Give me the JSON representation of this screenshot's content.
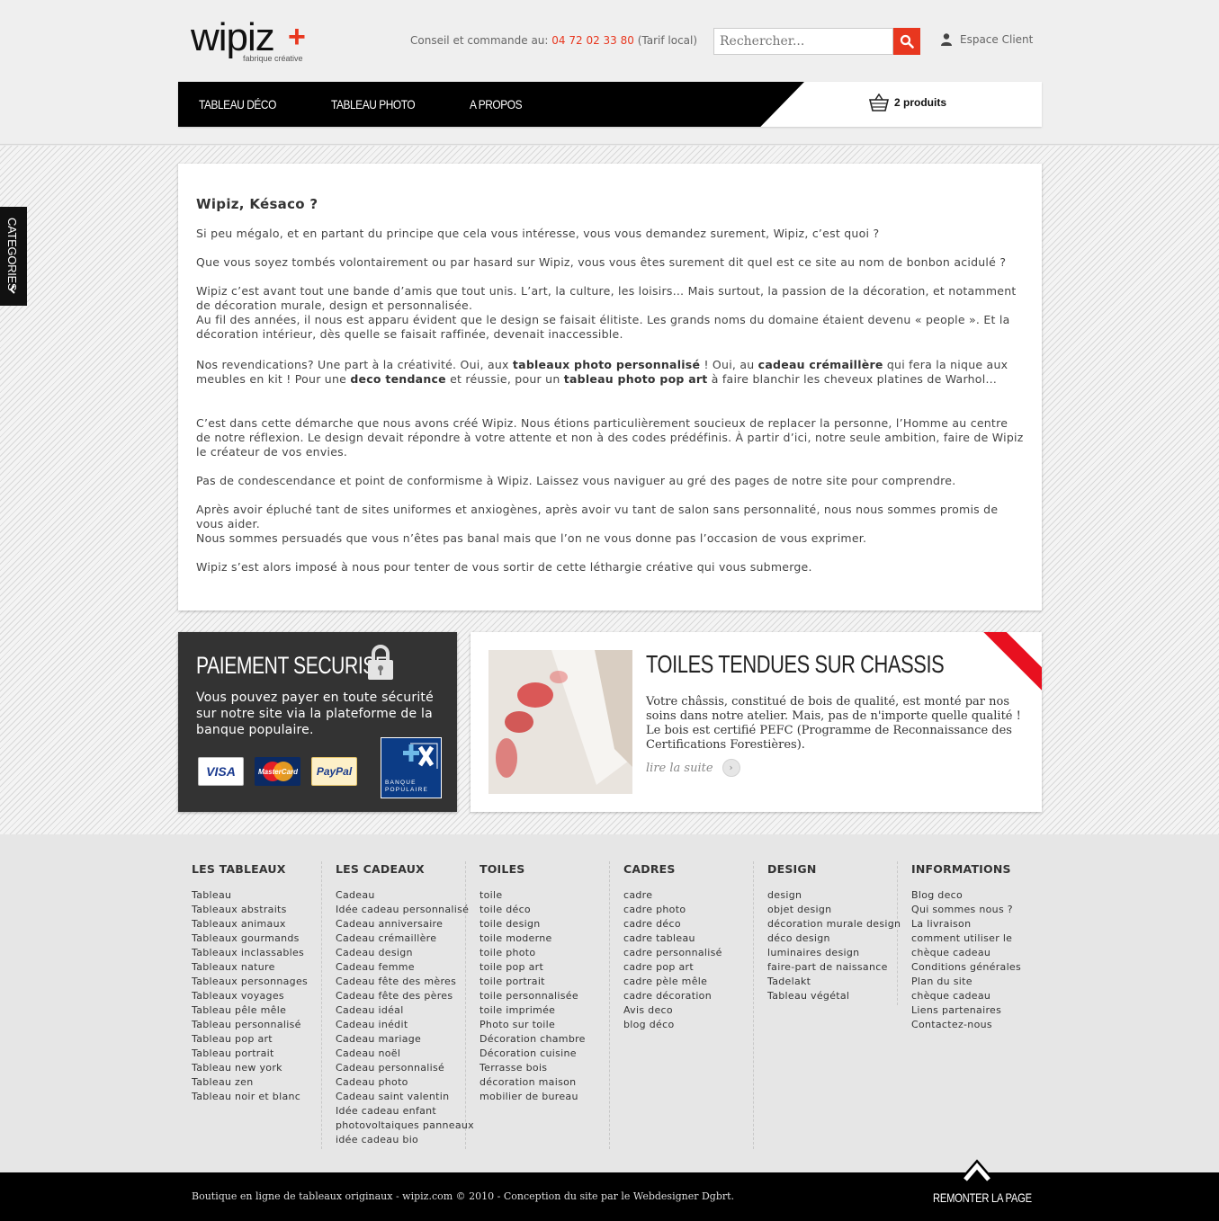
{
  "header": {
    "logo_text": "wipiz",
    "logo_plus": "+",
    "logo_tagline": "fabrique créative",
    "contact_label": "Conseil et commande au:",
    "contact_phone": "04 72 02 33 80",
    "contact_note": "(Tarif local)",
    "search_placeholder": "Rechercher...",
    "account_label": "Espace Client",
    "accent_color": "#e8371f"
  },
  "nav": {
    "items": [
      "TABLEAU DÉCO",
      "TABLEAU PHOTO",
      "A PROPOS"
    ],
    "cart_label": "2 produits"
  },
  "sidebar_tab": {
    "label": "CATEGORIES"
  },
  "article": {
    "title": "Wipiz, Késaco ?",
    "p1": "Si peu mégalo, et en partant du principe que cela vous intéresse, vous vous demandez surement, Wipiz, c’est quoi ?",
    "p2": "Que vous soyez tombés volontairement ou par hasard sur Wipiz, vous vous êtes surement dit quel est ce site au nom de bonbon acidulé ?",
    "p3": "Wipiz c’est avant tout une bande d’amis que tout unis. L’art, la culture, les loisirs… Mais surtout, la passion de la décoration, et notamment de décoration murale, design et personnalisée.",
    "p4": "Au fil des années, il nous est apparu évident que le design se faisait élitiste. Les grands noms du domaine étaient devenu « people ». Et la décoration intérieur, dès quelle se faisait raffinée, devenait inaccessible.",
    "p5": {
      "t1": "Nos revendications? Une part à la créativité. Oui, aux ",
      "b1": "tableaux photo personnalisé",
      "t2": " ! Oui, au ",
      "b2": "cadeau crémaillère",
      "t3": " qui fera la nique aux meubles en kit ! Pour une ",
      "b3": "deco tendance",
      "t4": " et réussie, pour un ",
      "b4": "tableau photo pop art",
      "t5": " à faire blanchir les cheveux platines de Warhol…"
    },
    "p6": "C’est dans cette démarche que nous avons créé Wipiz. Nous étions particulièrement soucieux de replacer la personne, l’Homme au centre de notre réflexion. Le design devait répondre à votre attente et non à des codes prédéfinis. À partir d’ici, notre seule ambition, faire de Wipiz le créateur de vos envies.",
    "p7": "Pas de condescendance et point de conformisme à Wipiz. Laissez vous naviguer au gré des pages de notre site pour comprendre.",
    "p8": "Après avoir épluché tant de sites uniformes et anxiogènes, après avoir vu tant de salon sans personnalité, nous nous sommes promis de vous aider.",
    "p9": "Nous sommes persuadés que vous n’êtes pas banal mais que l’on ne vous donne pas l’occasion de vous exprimer.",
    "p10": "Wipiz s’est alors imposé à nous pour tenter de vous sortir de cette léthargie créative qui vous submerge."
  },
  "payment": {
    "title": "PAIEMENT SECURISE",
    "text": "Vous pouvez payer en toute sécurité sur notre site via la plateforme de la banque populaire.",
    "cards": [
      "VISA",
      "MasterCard",
      "PayPal"
    ],
    "bank_line1": "BANQUE",
    "bank_line2": "POPULAIRE"
  },
  "promo": {
    "title": "TOILES TENDUES SUR CHASSIS",
    "text": "Votre châssis, constitué de bois de qualité, est monté par nos soins dans notre atelier. Mais, pas de n'importe quelle qualité ! Le bois est certifié PEFC (Programme de Reconnaissance des Certifications Forestières).",
    "more": "lire la suite"
  },
  "footer_columns": [
    {
      "title": "LES TABLEAUX",
      "links": [
        "Tableau",
        "Tableaux abstraits",
        "Tableaux animaux",
        "Tableaux gourmands",
        "Tableaux inclassables",
        "Tableaux nature",
        "Tableaux personnages",
        "Tableaux voyages",
        "Tableau pêle mêle",
        "Tableau personnalisé",
        "Tableau pop art",
        "Tableau portrait",
        "Tableau new york",
        "Tableau zen",
        "Tableau noir et blanc"
      ]
    },
    {
      "title": "LES CADEAUX",
      "links": [
        "Cadeau",
        "Idée cadeau personnalisé",
        "Cadeau anniversaire",
        "Cadeau crémaillère",
        "Cadeau design",
        "Cadeau femme",
        "Cadeau fête des mères",
        "Cadeau fête des pères",
        "Cadeau idéal",
        "Cadeau inédit",
        "Cadeau mariage",
        "Cadeau noël",
        "Cadeau personnalisé",
        "Cadeau photo",
        "Cadeau saint valentin",
        "Idée cadeau enfant",
        "photovoltaiques panneaux",
        "idée cadeau bio"
      ]
    },
    {
      "title": "TOILES",
      "links": [
        "toile",
        "toile déco",
        "toile design",
        "toile moderne",
        "toile photo",
        "toile pop art",
        "toile portrait",
        "toile personnalisée",
        "toile imprimée",
        "Photo sur toile",
        "Décoration chambre",
        "Décoration cuisine",
        "Terrasse bois",
        "décoration maison",
        "mobilier de bureau"
      ]
    },
    {
      "title": "CADRES",
      "links": [
        "cadre",
        "cadre photo",
        "cadre déco",
        "cadre tableau",
        "cadre personnalisé",
        "cadre pop art",
        "cadre pèle mêle",
        "cadre décoration",
        "Avis deco",
        "blog déco"
      ]
    },
    {
      "title": "DESIGN",
      "links": [
        "design",
        "objet design",
        "décoration murale design",
        "déco design",
        "luminaires design",
        "faire-part de naissance",
        "Tadelakt",
        "Tableau végétal"
      ]
    },
    {
      "title": "INFORMATIONS",
      "links": [
        "Blog deco",
        "Qui sommes nous ?",
        "La livraison",
        "comment utiliser le",
        "chèque cadeau",
        "Conditions générales",
        "Plan du site",
        "chèque cadeau",
        "Liens partenaires",
        "Contactez-nous"
      ]
    }
  ],
  "bottom": {
    "copyright": "Boutique en ligne de tableaux originaux - wipiz.com © 2010 - Conception du site par le Webdesigner Dgbrt.",
    "back_to_top": "REMONTER LA PAGE"
  }
}
